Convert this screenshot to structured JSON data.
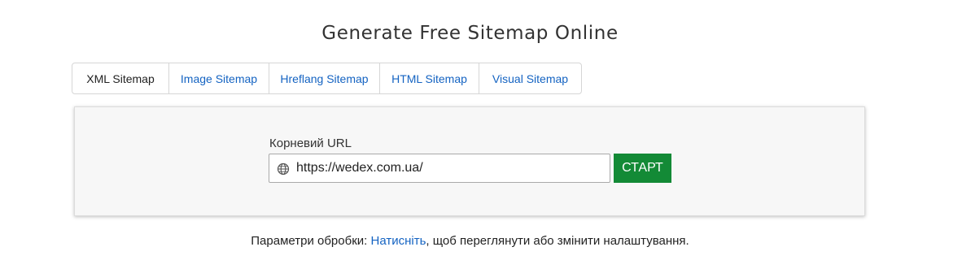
{
  "page": {
    "title": "Generate Free Sitemap Online"
  },
  "tabs": [
    {
      "label": "XML Sitemap",
      "active": true
    },
    {
      "label": "Image Sitemap",
      "active": false
    },
    {
      "label": "Hreflang Sitemap",
      "active": false
    },
    {
      "label": "HTML Sitemap",
      "active": false
    },
    {
      "label": "Visual Sitemap",
      "active": false
    }
  ],
  "form": {
    "url_label": "Корневий URL",
    "url_value": "https://wedex.com.ua/",
    "url_icon": "globe-icon",
    "start_label": "СТАРТ"
  },
  "settings": {
    "prefix": "Параметри обробки: ",
    "link_text": "Натисніть",
    "suffix": ", щоб переглянути або змінити налаштування."
  },
  "colors": {
    "link": "#1463c2",
    "start_button": "#138a36",
    "panel_background": "#f7f7f7"
  }
}
